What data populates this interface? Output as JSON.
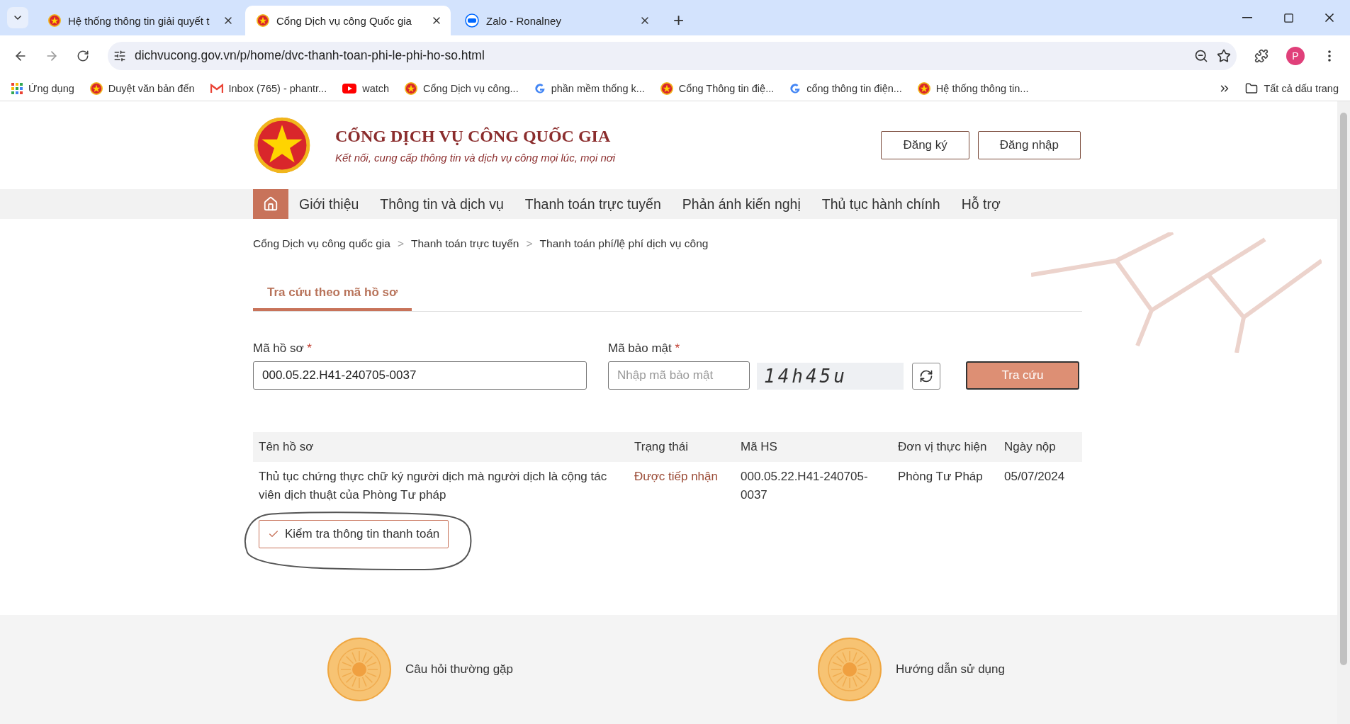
{
  "browser": {
    "tabs": [
      {
        "title": "Hệ thống thông tin giải quyết t",
        "kind": "emblem",
        "selected": false
      },
      {
        "title": "Cổng Dịch vụ công Quốc gia",
        "kind": "emblem",
        "selected": true
      },
      {
        "title": "Zalo - Ronalney",
        "kind": "zalo",
        "selected": false
      }
    ],
    "tab_new": "+",
    "url": "dichvucong.gov.vn/p/home/dvc-thanh-toan-phi-le-phi-ho-so.html",
    "profile": "P",
    "bookmarks": [
      {
        "label": "Ứng dụng",
        "kind": "apps"
      },
      {
        "label": "Duyệt văn bản đến",
        "kind": "emblem"
      },
      {
        "label": "Inbox (765) - phantr...",
        "kind": "gmail"
      },
      {
        "label": "watch",
        "kind": "youtube"
      },
      {
        "label": "Cổng Dịch vụ công...",
        "kind": "emblem"
      },
      {
        "label": "phần mềm thống k...",
        "kind": "google"
      },
      {
        "label": "Cổng Thông tin điệ...",
        "kind": "emblem"
      },
      {
        "label": "cổng thông tin điện...",
        "kind": "google"
      },
      {
        "label": "Hệ thống thông tin...",
        "kind": "emblem"
      }
    ],
    "all_bookmarks": "Tất cả dấu trang"
  },
  "header": {
    "title": "CỔNG DỊCH VỤ CÔNG QUỐC GIA",
    "subtitle": "Kết nối, cung cấp thông tin và dịch vụ công mọi lúc, mọi nơi",
    "buttons": [
      "Đăng ký",
      "Đăng nhập"
    ]
  },
  "nav": {
    "items": [
      "Giới thiệu",
      "Thông tin và dịch vụ",
      "Thanh toán trực tuyến",
      "Phản ánh kiến nghị",
      "Thủ tục hành chính",
      "Hỗ trợ"
    ]
  },
  "breadcrumb": [
    "Cổng Dịch vụ công quốc gia",
    "Thanh toán trực tuyến",
    "Thanh toán phí/lệ phí dịch vụ công"
  ],
  "breadcrumb_separator": ">",
  "search_tabs": [
    {
      "label": "Tra cứu theo mã hồ sơ",
      "selected": true
    }
  ],
  "form": {
    "record_label": "Mã hồ sơ",
    "record_value": "000.05.22.H41-240705-0037",
    "security_label": "Mã bảo mật",
    "required_mark": "*",
    "security_placeholder": "Nhập mã bảo mật",
    "captcha": "14h45u",
    "submit": "Tra cứu"
  },
  "table": {
    "columns": [
      "Tên hồ sơ",
      "Trạng thái",
      "Mã HS",
      "Đơn vị thực hiện",
      "Ngày nộp"
    ],
    "rows": [
      {
        "name": "Thủ tục chứng thực chữ ký người dịch mà người dịch là cộng tác viên dịch thuật của Phòng Tư pháp",
        "status": "Được tiếp nhận",
        "code": "000.05.22.H41-240705-0037",
        "unit": "Phòng Tư Pháp",
        "date": "05/07/2024",
        "action": "Kiểm tra thông tin thanh toán"
      }
    ]
  },
  "footer": {
    "items": [
      "Câu hỏi thường gặp",
      "Hướng dẫn sử dụng"
    ]
  }
}
